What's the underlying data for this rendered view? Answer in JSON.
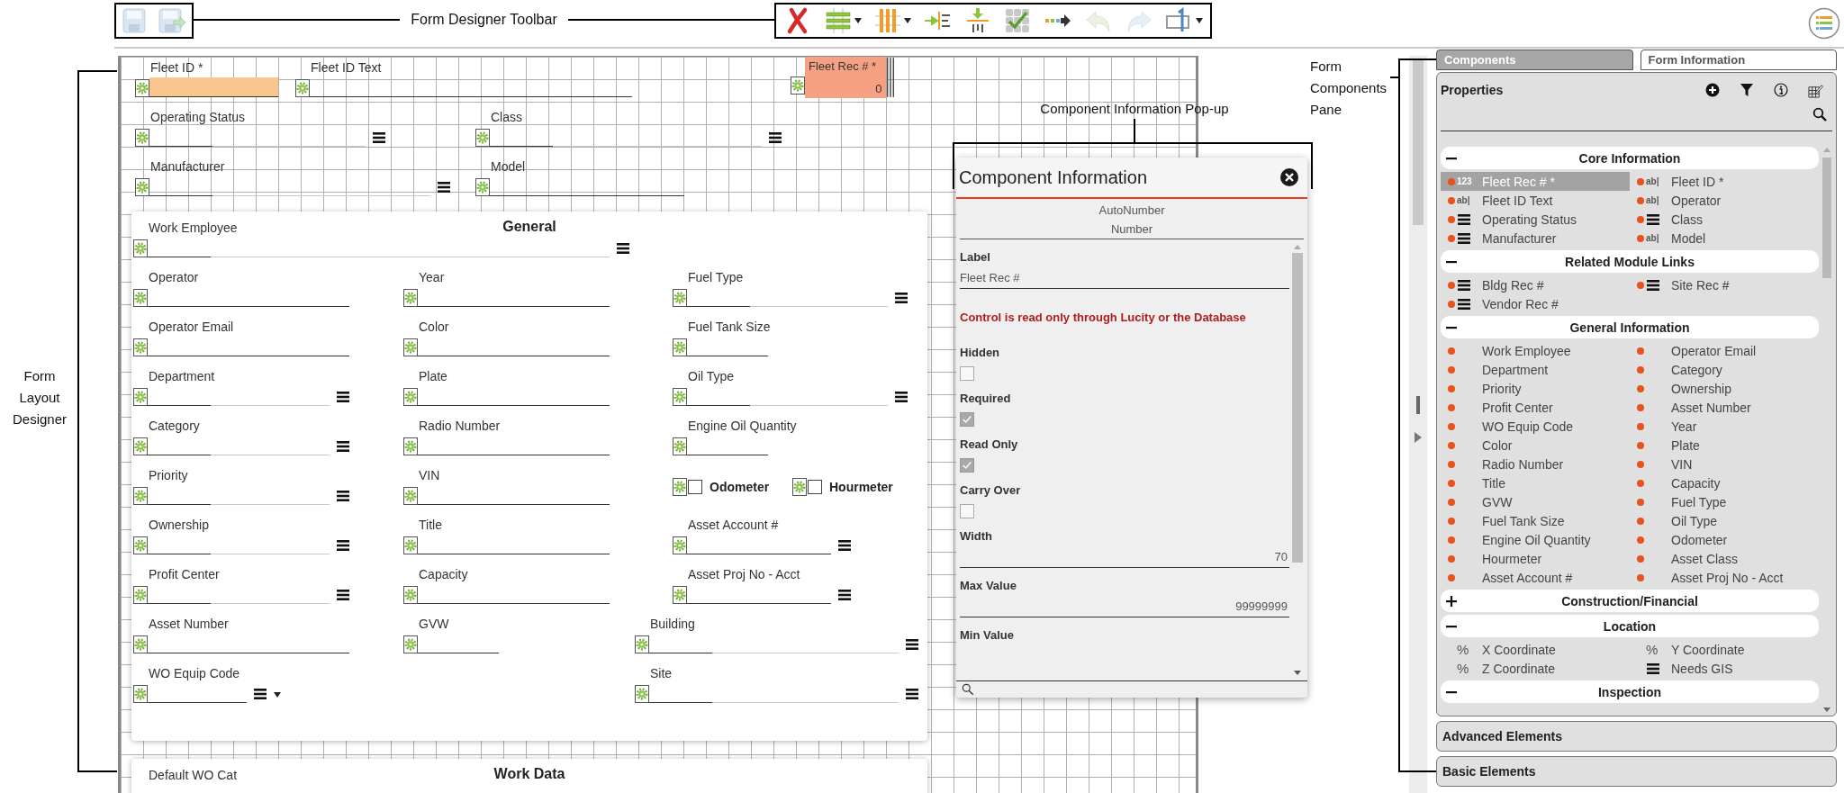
{
  "topbar": {
    "save_buttons": [
      {
        "kind": "save",
        "disabled": true
      },
      {
        "kind": "save-close",
        "disabled": true
      }
    ],
    "tools": [
      {
        "kind": "delete",
        "disabled": false,
        "dropdown": false
      },
      {
        "kind": "rows",
        "disabled": false,
        "dropdown": true
      },
      {
        "kind": "columns",
        "disabled": false,
        "dropdown": true
      },
      {
        "kind": "indent",
        "disabled": false,
        "dropdown": false
      },
      {
        "kind": "insert",
        "disabled": false,
        "dropdown": false
      },
      {
        "kind": "grid-check",
        "disabled": false,
        "dropdown": false
      },
      {
        "kind": "move-right",
        "disabled": false,
        "dropdown": false
      },
      {
        "kind": "undo",
        "disabled": true,
        "dropdown": false
      },
      {
        "kind": "redo",
        "disabled": true,
        "dropdown": false
      },
      {
        "kind": "number-box",
        "disabled": false,
        "dropdown": true
      }
    ]
  },
  "callouts": {
    "toolbar": "Form Designer Toolbar",
    "layout": "Form Layout Designer",
    "popup": "Component Information Pop-up",
    "pane": "Form Components Pane"
  },
  "canvas": {
    "header_fields": [
      {
        "label": "Fleet ID *",
        "kind": "required"
      },
      {
        "label": "Fleet ID Text",
        "kind": "text"
      },
      {
        "label": "Fleet Rec # *",
        "kind": "autonumber",
        "value": "0"
      },
      {
        "label": "Operating Status",
        "kind": "list"
      },
      {
        "label": "Class",
        "kind": "list"
      },
      {
        "label": "Manufacturer",
        "kind": "list"
      },
      {
        "label": "Model",
        "kind": "text"
      }
    ],
    "sections": [
      {
        "title": "General",
        "fields": [
          {
            "label": "Work Employee",
            "kind": "list"
          },
          {
            "label": "Operator",
            "kind": "text"
          },
          {
            "label": "Year",
            "kind": "text"
          },
          {
            "label": "Fuel Type",
            "kind": "list"
          },
          {
            "label": "Operator Email",
            "kind": "text"
          },
          {
            "label": "Color",
            "kind": "text"
          },
          {
            "label": "Fuel Tank Size",
            "kind": "short"
          },
          {
            "label": "Department",
            "kind": "list"
          },
          {
            "label": "Plate",
            "kind": "text"
          },
          {
            "label": "Oil Type",
            "kind": "list"
          },
          {
            "label": "Category",
            "kind": "list"
          },
          {
            "label": "Radio Number",
            "kind": "text"
          },
          {
            "label": "Engine Oil Quantity",
            "kind": "short"
          },
          {
            "label": "Priority",
            "kind": "list"
          },
          {
            "label": "VIN",
            "kind": "text"
          },
          {
            "label": "Odometer",
            "kind": "checkbox",
            "checked": false
          },
          {
            "label": "Hourmeter",
            "kind": "checkbox",
            "checked": false
          },
          {
            "label": "Ownership",
            "kind": "list"
          },
          {
            "label": "Title",
            "kind": "text"
          },
          {
            "label": "Asset Account #",
            "kind": "picker"
          },
          {
            "label": "Profit Center",
            "kind": "list"
          },
          {
            "label": "Capacity",
            "kind": "text"
          },
          {
            "label": "Asset Proj No - Acct",
            "kind": "picker"
          },
          {
            "label": "Asset Number",
            "kind": "text"
          },
          {
            "label": "GVW",
            "kind": "short"
          },
          {
            "label": "Building",
            "kind": "list"
          },
          {
            "label": "WO Equip Code",
            "kind": "dropdown"
          },
          {
            "label": "Site",
            "kind": "list"
          }
        ]
      },
      {
        "title": "Work Data",
        "fields": [
          {
            "label": "Default WO Cat"
          }
        ]
      }
    ]
  },
  "popup": {
    "title": "Component Information",
    "types": [
      "AutoNumber",
      "Number"
    ],
    "properties": [
      {
        "kind": "text",
        "label": "Label",
        "value": "Fleet Rec #"
      },
      {
        "kind": "warning",
        "text": "Control is read only through Lucity or the Database"
      },
      {
        "kind": "checkbox",
        "label": "Hidden",
        "checked": false
      },
      {
        "kind": "checkbox",
        "label": "Required",
        "checked": true
      },
      {
        "kind": "checkbox",
        "label": "Read Only",
        "checked": true
      },
      {
        "kind": "checkbox",
        "label": "Carry Over",
        "checked": false
      },
      {
        "kind": "number",
        "label": "Width",
        "value": "70"
      },
      {
        "kind": "number",
        "label": "Max Value",
        "value": "99999999"
      },
      {
        "kind": "number",
        "label": "Min Value"
      }
    ]
  },
  "pane": {
    "tabs": [
      {
        "label": "Components",
        "selected": true
      },
      {
        "label": "Form Information",
        "selected": false
      }
    ],
    "panel_title": "Properties",
    "groups": [
      {
        "title": "Core Information",
        "expanded": true,
        "items": [
          {
            "label": "Fleet Rec # *",
            "kind": "badge",
            "badge": "123",
            "on_form": true,
            "selected": true
          },
          {
            "label": "Fleet ID *",
            "kind": "badge",
            "badge": "ab|",
            "on_form": true,
            "selected": false
          },
          {
            "label": "Fleet ID Text",
            "kind": "badge",
            "badge": "ab|",
            "on_form": true,
            "selected": false
          },
          {
            "label": "Operator",
            "kind": "badge",
            "badge": "ab|",
            "on_form": true,
            "selected": false
          },
          {
            "label": "Operating Status",
            "kind": "list",
            "on_form": true,
            "selected": false
          },
          {
            "label": "Class",
            "kind": "list",
            "on_form": true,
            "selected": false
          },
          {
            "label": "Manufacturer",
            "kind": "list",
            "on_form": true,
            "selected": false
          },
          {
            "label": "Model",
            "kind": "badge",
            "badge": "ab|",
            "on_form": true,
            "selected": false
          }
        ]
      },
      {
        "title": "Related Module Links",
        "expanded": true,
        "items": [
          {
            "label": "Bldg Rec #",
            "kind": "list",
            "on_form": true,
            "selected": false
          },
          {
            "label": "Site Rec #",
            "kind": "list",
            "on_form": true,
            "selected": false
          },
          {
            "label": "Vendor Rec #",
            "kind": "list",
            "on_form": true,
            "selected": false
          }
        ]
      },
      {
        "title": "General Information",
        "expanded": true,
        "items": [
          {
            "label": "Work Employee",
            "kind": "plain",
            "on_form": true,
            "selected": false
          },
          {
            "label": "Operator Email",
            "kind": "plain",
            "on_form": true,
            "selected": false
          },
          {
            "label": "Department",
            "kind": "plain",
            "on_form": true,
            "selected": false
          },
          {
            "label": "Category",
            "kind": "plain",
            "on_form": true,
            "selected": false
          },
          {
            "label": "Priority",
            "kind": "plain",
            "on_form": true,
            "selected": false
          },
          {
            "label": "Ownership",
            "kind": "plain",
            "on_form": true,
            "selected": false
          },
          {
            "label": "Profit Center",
            "kind": "plain",
            "on_form": true,
            "selected": false
          },
          {
            "label": "Asset Number",
            "kind": "plain",
            "on_form": true,
            "selected": false
          },
          {
            "label": "WO Equip Code",
            "kind": "plain",
            "on_form": true,
            "selected": false
          },
          {
            "label": "Year",
            "kind": "plain",
            "on_form": true,
            "selected": false
          },
          {
            "label": "Color",
            "kind": "plain",
            "on_form": true,
            "selected": false
          },
          {
            "label": "Plate",
            "kind": "plain",
            "on_form": true,
            "selected": false
          },
          {
            "label": "Radio Number",
            "kind": "plain",
            "on_form": true,
            "selected": false
          },
          {
            "label": "VIN",
            "kind": "plain",
            "on_form": true,
            "selected": false
          },
          {
            "label": "Title",
            "kind": "plain",
            "on_form": true,
            "selected": false
          },
          {
            "label": "Capacity",
            "kind": "plain",
            "on_form": true,
            "selected": false
          },
          {
            "label": "GVW",
            "kind": "plain",
            "on_form": true,
            "selected": false
          },
          {
            "label": "Fuel Type",
            "kind": "plain",
            "on_form": true,
            "selected": false
          },
          {
            "label": "Fuel Tank Size",
            "kind": "plain",
            "on_form": true,
            "selected": false
          },
          {
            "label": "Oil Type",
            "kind": "plain",
            "on_form": true,
            "selected": false
          },
          {
            "label": "Engine Oil Quantity",
            "kind": "plain",
            "on_form": true,
            "selected": false
          },
          {
            "label": "Odometer",
            "kind": "plain",
            "on_form": true,
            "selected": false
          },
          {
            "label": "Hourmeter",
            "kind": "plain",
            "on_form": true,
            "selected": false
          },
          {
            "label": "Asset Class",
            "kind": "plain",
            "on_form": true,
            "selected": false
          },
          {
            "label": "Asset Account #",
            "kind": "plain",
            "on_form": true,
            "selected": false
          },
          {
            "label": "Asset Proj No - Acct",
            "kind": "plain",
            "on_form": true,
            "selected": false
          }
        ]
      },
      {
        "title": "Construction/Financial",
        "expanded": false
      },
      {
        "title": "Location",
        "expanded": true,
        "items": [
          {
            "label": "X Coordinate",
            "kind": "badge",
            "badge": "%",
            "on_form": false,
            "selected": false
          },
          {
            "label": "Y Coordinate",
            "kind": "badge",
            "badge": "%",
            "on_form": false,
            "selected": false
          },
          {
            "label": "Z Coordinate",
            "kind": "badge",
            "badge": "%",
            "on_form": false,
            "selected": false
          },
          {
            "label": "Needs GIS",
            "kind": "list",
            "on_form": false,
            "selected": false
          }
        ]
      },
      {
        "title": "Inspection",
        "expanded": true
      }
    ],
    "footers": [
      "Advanced Elements",
      "Basic Elements"
    ]
  }
}
